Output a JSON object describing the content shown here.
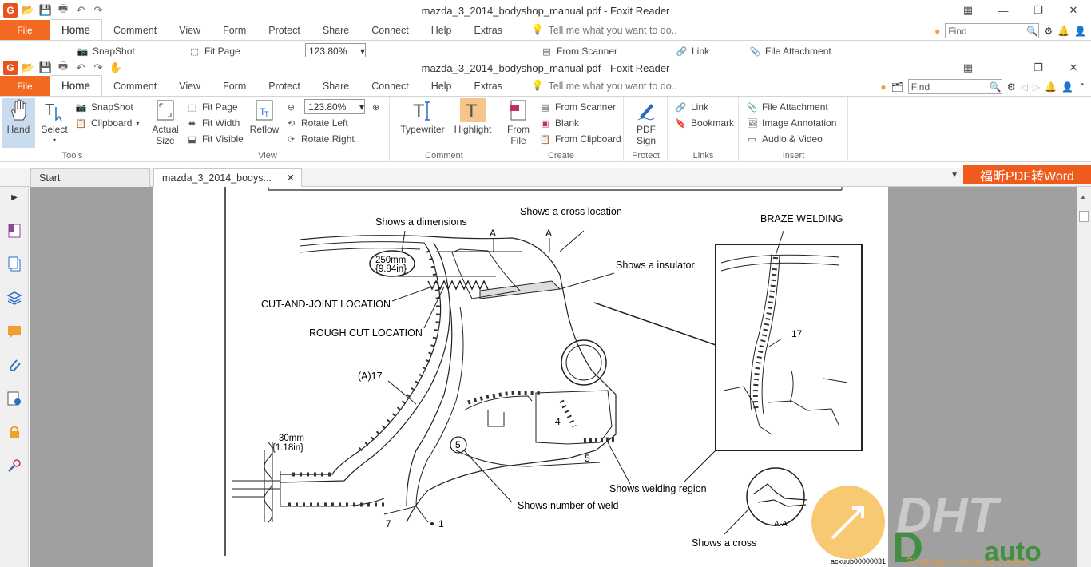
{
  "app": {
    "title": "mazda_3_2014_bodyshop_manual.pdf - Foxit Reader"
  },
  "ribbon_tabs": [
    "File",
    "Home",
    "Comment",
    "View",
    "Form",
    "Protect",
    "Share",
    "Connect",
    "Help",
    "Extras"
  ],
  "tell_me": "Tell me what you want to do..",
  "find_placeholder": "Find",
  "ribbon_top_strip": {
    "snapshot": "SnapShot",
    "fit_page": "Fit Page",
    "zoom": "123.80%",
    "from_scanner": "From Scanner",
    "link": "Link",
    "file_attachment": "File Attachment"
  },
  "ribbon": {
    "tools": {
      "label": "Tools",
      "hand": "Hand",
      "select": "Select",
      "snapshot": "SnapShot",
      "clipboard": "Clipboard"
    },
    "view": {
      "label": "View",
      "actual_size_1": "Actual",
      "actual_size_2": "Size",
      "fit_page": "Fit Page",
      "fit_width": "Fit Width",
      "fit_visible": "Fit Visible",
      "reflow": "Reflow",
      "zoom": "123.80%",
      "rotate_left": "Rotate Left",
      "rotate_right": "Rotate Right"
    },
    "comment": {
      "label": "Comment",
      "typewriter": "Typewriter",
      "highlight": "Highlight"
    },
    "create": {
      "label": "Create",
      "from_file_1": "From",
      "from_file_2": "File",
      "from_scanner": "From Scanner",
      "blank": "Blank",
      "from_clipboard": "From Clipboard"
    },
    "protect": {
      "label": "Protect",
      "pdf_sign_1": "PDF",
      "pdf_sign_2": "Sign"
    },
    "links": {
      "label": "Links",
      "link": "Link",
      "bookmark": "Bookmark"
    },
    "insert": {
      "label": "Insert",
      "file_attachment": "File Attachment",
      "image_annotation": "Image Annotation",
      "audio_video": "Audio & Video"
    }
  },
  "doc_tabs": [
    "Start",
    "mazda_3_2014_bodys..."
  ],
  "promo": "福昕PDF转Word",
  "figure": {
    "shows_dimensions": "Shows a dimensions",
    "shows_cross_location": "Shows a cross location",
    "marker_a1": "A",
    "marker_a2": "A",
    "braze_welding": "BRAZE WELDING",
    "dim_250_1": "250mm",
    "dim_250_2": "{9.84in}",
    "shows_insulator": "Shows a insulator",
    "cut_and_joint": "CUT-AND-JOINT LOCATION",
    "rough_cut": "ROUGH CUT LOCATION",
    "part_17": "17",
    "part_a17": "(A)17",
    "part_4": "4",
    "part_5a": "5",
    "part_5b": "5",
    "dim_30_1": "30mm",
    "dim_30_2": "{1.18in}",
    "shows_welding_region": "Shows welding region",
    "shows_number_of_weld": "Shows number of weld",
    "part_7": "7",
    "part_1": "1",
    "shows_a_cross": "Shows a cross",
    "section_aa": "A-A",
    "figure_id": "acxuub00000031"
  },
  "watermark": {
    "brand": "DHT",
    "brand2": "auto",
    "slogan": "Sharing creates success"
  }
}
